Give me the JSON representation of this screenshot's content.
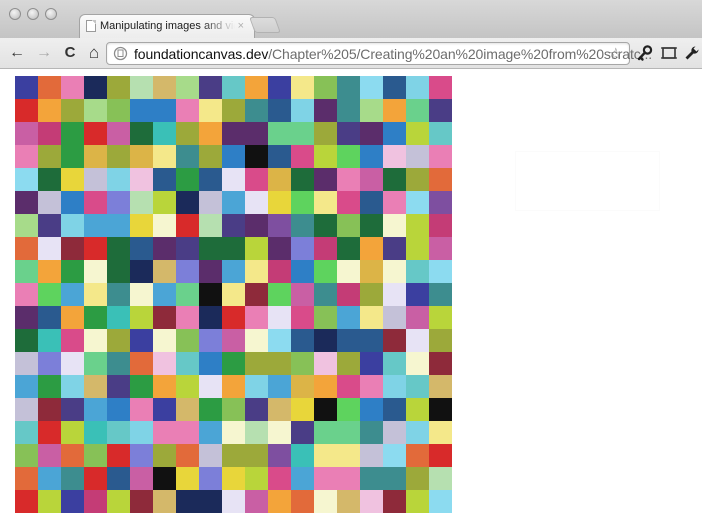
{
  "browser": {
    "tab": {
      "title": "Manipulating images and video",
      "close_icon": "close-icon",
      "favicon_icon": "blank-page-icon"
    },
    "toolbar": {
      "back_icon": "back-arrow-icon",
      "forward_icon": "forward-arrow-icon",
      "reload_icon": "reload-icon",
      "home_icon": "home-icon",
      "address": {
        "host": "foundationcanvas.dev",
        "path": "/Chapter%205/Creating%20an%20image%20from%20scratc...",
        "page_icon": "page-info-icon"
      },
      "bookmark_icon": "star-icon",
      "page_menu_icon": "page-menu-icon",
      "extension_icon": "window-icon",
      "tools_icon": "wrench-icon"
    },
    "glyphs": {
      "back": "←",
      "forward": "→",
      "reload": "C",
      "home": "⌂",
      "star": "☆",
      "close": "×"
    }
  },
  "canvas": {
    "description_colors_note": "random-color pixel grid",
    "columns": 19,
    "rows": 19,
    "palette": [
      "#e8d63a",
      "#3b3fa0",
      "#111111",
      "#b9d53a",
      "#4a3d86",
      "#87c157",
      "#2a5a8f",
      "#dcb447",
      "#d82a2a",
      "#f3a43a",
      "#d94b8a",
      "#7fd3e6",
      "#4ba5d6",
      "#2c9c43",
      "#6ad18c",
      "#9ca93a",
      "#c95fa4",
      "#7e4fa0",
      "#f4e88a",
      "#66c8c7",
      "#e7e3f5",
      "#8cdbf0",
      "#1e6c3a",
      "#c43c76",
      "#3ac0b7",
      "#7c7fd9",
      "#a7db8a",
      "#e26a3a",
      "#5b2d6b",
      "#f0c2e0",
      "#2e7fc6",
      "#b6e0b0",
      "#1b2a5a",
      "#d4b86a",
      "#8e2a3a",
      "#f6f6d0",
      "#5ed35e",
      "#ea7fb5",
      "#3d8d8f",
      "#c4c1d8"
    ]
  }
}
